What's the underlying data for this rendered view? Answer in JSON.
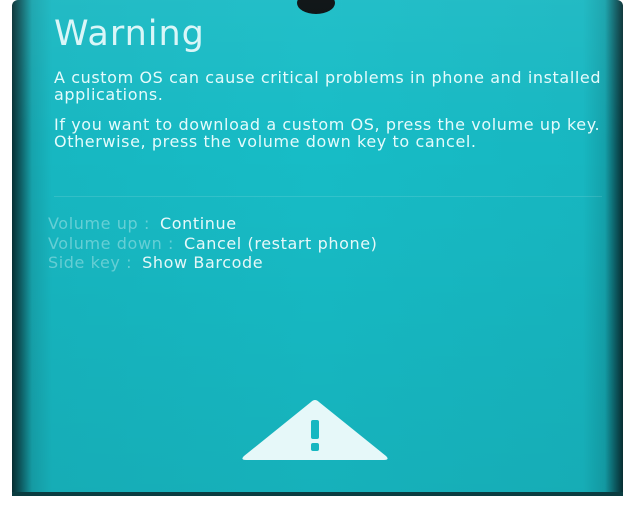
{
  "title": "Warning",
  "paragraph1": "A custom OS can cause critical problems in phone and installed applications.",
  "paragraph2": "If you want to download a custom OS, press the volume up key. Otherwise, press the volume down key to cancel.",
  "options": [
    {
      "key": "Volume up :",
      "action": "Continue"
    },
    {
      "key": "Volume down :",
      "action": "Cancel (restart phone)"
    },
    {
      "key": "Side key :",
      "action": "Show Barcode"
    }
  ],
  "icons": {
    "warning": "warning-triangle-icon",
    "camera": "front-camera-hole"
  },
  "colors": {
    "screen_background": "#17bcc6",
    "text": "#e4fbfc",
    "key_text": "#7fd9df"
  }
}
